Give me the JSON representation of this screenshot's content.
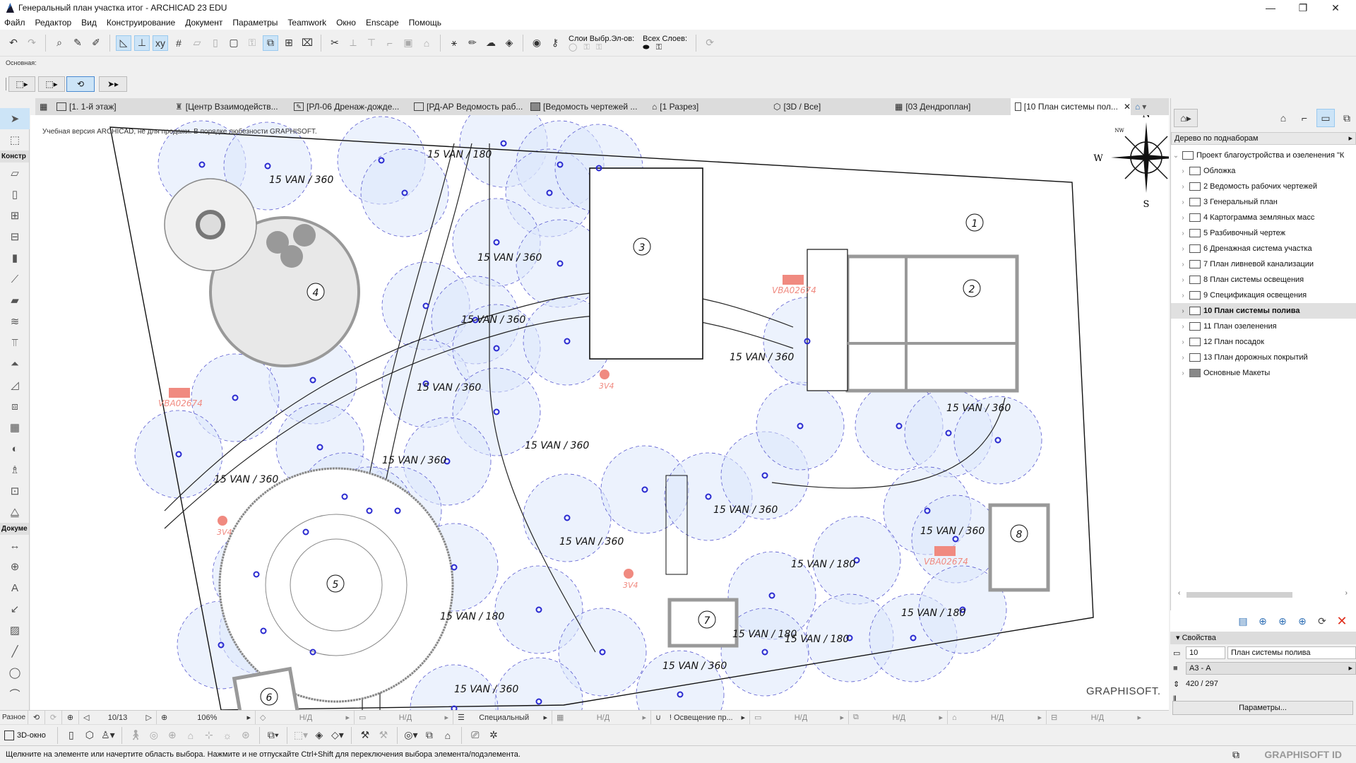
{
  "window": {
    "title": "Генеральный план участка итог - ARCHICAD 23 EDU"
  },
  "menu": [
    "Файл",
    "Редактор",
    "Вид",
    "Конструирование",
    "Документ",
    "Параметры",
    "Teamwork",
    "Окно",
    "Enscape",
    "Помощь"
  ],
  "toolbar": {
    "layers_selected_label": "Слои Выбр.Эл-ов:",
    "all_layers_label": "Всех Слоев:",
    "info_group_label": "Основная:"
  },
  "tabs": [
    {
      "label": "[1. 1-й этаж]",
      "icon": "floor-plan-icon"
    },
    {
      "label": "[Центр Взаимодейств...",
      "icon": "lighthouse-icon"
    },
    {
      "label": "[РЛ-06 Дренаж-дожде...",
      "icon": "drawing-icon"
    },
    {
      "label": "[РД-АР Ведомость раб...",
      "icon": "layout-icon"
    },
    {
      "label": "[Ведомость чертежей ...",
      "icon": "schedule-icon"
    },
    {
      "label": "[1 Разрез]",
      "icon": "section-icon"
    },
    {
      "label": "[3D / Все]",
      "icon": "3d-icon"
    },
    {
      "label": "[03 Дендроплан]",
      "icon": "grid-icon"
    },
    {
      "label": "[10 План системы пол...",
      "icon": "layout-icon",
      "active": true
    }
  ],
  "toolbox": {
    "groups": [
      "Констр",
      "Докуме",
      "Разное"
    ]
  },
  "canvas": {
    "edu_notice": "Учебная версия ARCHICAD, не для продажи. В порядке любезности GRAPHISOFT.",
    "watermark": "GRAPHISOFT.",
    "compass": {
      "n": "N",
      "s": "S",
      "w": "W",
      "nw": "NW"
    },
    "zones": [
      "1",
      "2",
      "3",
      "4",
      "5",
      "6",
      "7",
      "8"
    ],
    "sprinkler_labels": [
      "15 VAN / 180",
      "15 VAN / 360",
      "15 VAN / 360",
      "15 VAN / 360",
      "15 VAN / 360",
      "15 VAN / 360",
      "15 VAN / 360",
      "15 VAN / 360",
      "15 VAN / 360",
      "15 VAN / 360",
      "15 VAN / 360",
      "15 VAN / 360",
      "15 VAN / 360",
      "15 VAN / 180",
      "15 VAN / 180",
      "15 VAN / 180",
      "15 VAN / 180",
      "15 VAN / 180",
      "15 VAN / 360",
      "15 VAN / 360"
    ],
    "valve_labels": [
      "VBA02674",
      "VBA02674",
      "VBA02674"
    ],
    "lamp_labels": [
      "3V4",
      "3V4",
      "3V4"
    ]
  },
  "navbar": {
    "group": "Разное",
    "page": "10/13",
    "zoom": "106%",
    "na": "Н/Д",
    "pen_set": "Специальный",
    "layer_combo": "! Освещение пр..."
  },
  "bottombar": {
    "3d_window": "3D-окно"
  },
  "status": "Щелкните на элементе или начертите область выбора. Нажмите и не отпускайте Ctrl+Shift для переключения выбора элемента/подэлемента.",
  "graphisoft_id": "GRAPHISOFT ID",
  "navigator": {
    "mode": "Дерево по поднаборам",
    "root": "Проект благоустройства и озеленения \"К",
    "items": [
      "Обложка",
      "2 Ведомость рабочих чертежей",
      "3 Генеральный план",
      "4 Картограмма земляных масс",
      "5 Разбивочный чертеж",
      "6 Дренажная система участка",
      "7 План ливневой канализации",
      "8 План системы освещения",
      "9 Спецификация освещения",
      "10 План системы полива",
      "11 План озеленения",
      "12 План посадок",
      "13 План дорожных покрытий",
      "Основные Макеты"
    ],
    "selected_index": 9
  },
  "properties": {
    "header": "Свойства",
    "id": "10",
    "name": "План системы полива",
    "format": "А3 - А",
    "size": "420 / 297",
    "params_button": "Параметры..."
  },
  "colors": {
    "accent": "#cce4f7",
    "sprinkler": "#2a2ad0",
    "coverage": "#dce8fb",
    "valve": "#f08a80",
    "delete": "#e0301e"
  }
}
